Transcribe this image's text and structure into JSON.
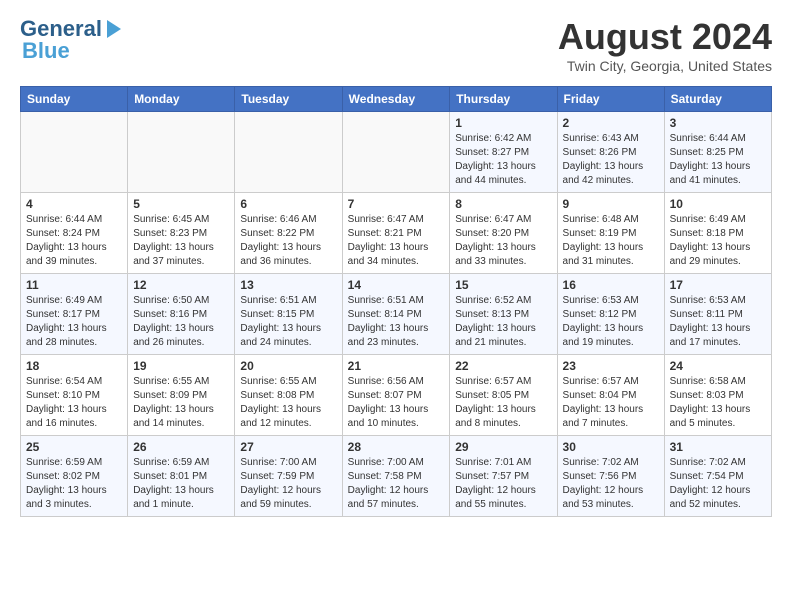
{
  "header": {
    "logo_line1": "General",
    "logo_line2": "Blue",
    "month_year": "August 2024",
    "location": "Twin City, Georgia, United States"
  },
  "weekdays": [
    "Sunday",
    "Monday",
    "Tuesday",
    "Wednesday",
    "Thursday",
    "Friday",
    "Saturday"
  ],
  "weeks": [
    [
      {
        "day": "",
        "sunrise": "",
        "sunset": "",
        "daylight": ""
      },
      {
        "day": "",
        "sunrise": "",
        "sunset": "",
        "daylight": ""
      },
      {
        "day": "",
        "sunrise": "",
        "sunset": "",
        "daylight": ""
      },
      {
        "day": "",
        "sunrise": "",
        "sunset": "",
        "daylight": ""
      },
      {
        "day": "1",
        "sunrise": "Sunrise: 6:42 AM",
        "sunset": "Sunset: 8:27 PM",
        "daylight": "Daylight: 13 hours and 44 minutes."
      },
      {
        "day": "2",
        "sunrise": "Sunrise: 6:43 AM",
        "sunset": "Sunset: 8:26 PM",
        "daylight": "Daylight: 13 hours and 42 minutes."
      },
      {
        "day": "3",
        "sunrise": "Sunrise: 6:44 AM",
        "sunset": "Sunset: 8:25 PM",
        "daylight": "Daylight: 13 hours and 41 minutes."
      }
    ],
    [
      {
        "day": "4",
        "sunrise": "Sunrise: 6:44 AM",
        "sunset": "Sunset: 8:24 PM",
        "daylight": "Daylight: 13 hours and 39 minutes."
      },
      {
        "day": "5",
        "sunrise": "Sunrise: 6:45 AM",
        "sunset": "Sunset: 8:23 PM",
        "daylight": "Daylight: 13 hours and 37 minutes."
      },
      {
        "day": "6",
        "sunrise": "Sunrise: 6:46 AM",
        "sunset": "Sunset: 8:22 PM",
        "daylight": "Daylight: 13 hours and 36 minutes."
      },
      {
        "day": "7",
        "sunrise": "Sunrise: 6:47 AM",
        "sunset": "Sunset: 8:21 PM",
        "daylight": "Daylight: 13 hours and 34 minutes."
      },
      {
        "day": "8",
        "sunrise": "Sunrise: 6:47 AM",
        "sunset": "Sunset: 8:20 PM",
        "daylight": "Daylight: 13 hours and 33 minutes."
      },
      {
        "day": "9",
        "sunrise": "Sunrise: 6:48 AM",
        "sunset": "Sunset: 8:19 PM",
        "daylight": "Daylight: 13 hours and 31 minutes."
      },
      {
        "day": "10",
        "sunrise": "Sunrise: 6:49 AM",
        "sunset": "Sunset: 8:18 PM",
        "daylight": "Daylight: 13 hours and 29 minutes."
      }
    ],
    [
      {
        "day": "11",
        "sunrise": "Sunrise: 6:49 AM",
        "sunset": "Sunset: 8:17 PM",
        "daylight": "Daylight: 13 hours and 28 minutes."
      },
      {
        "day": "12",
        "sunrise": "Sunrise: 6:50 AM",
        "sunset": "Sunset: 8:16 PM",
        "daylight": "Daylight: 13 hours and 26 minutes."
      },
      {
        "day": "13",
        "sunrise": "Sunrise: 6:51 AM",
        "sunset": "Sunset: 8:15 PM",
        "daylight": "Daylight: 13 hours and 24 minutes."
      },
      {
        "day": "14",
        "sunrise": "Sunrise: 6:51 AM",
        "sunset": "Sunset: 8:14 PM",
        "daylight": "Daylight: 13 hours and 23 minutes."
      },
      {
        "day": "15",
        "sunrise": "Sunrise: 6:52 AM",
        "sunset": "Sunset: 8:13 PM",
        "daylight": "Daylight: 13 hours and 21 minutes."
      },
      {
        "day": "16",
        "sunrise": "Sunrise: 6:53 AM",
        "sunset": "Sunset: 8:12 PM",
        "daylight": "Daylight: 13 hours and 19 minutes."
      },
      {
        "day": "17",
        "sunrise": "Sunrise: 6:53 AM",
        "sunset": "Sunset: 8:11 PM",
        "daylight": "Daylight: 13 hours and 17 minutes."
      }
    ],
    [
      {
        "day": "18",
        "sunrise": "Sunrise: 6:54 AM",
        "sunset": "Sunset: 8:10 PM",
        "daylight": "Daylight: 13 hours and 16 minutes."
      },
      {
        "day": "19",
        "sunrise": "Sunrise: 6:55 AM",
        "sunset": "Sunset: 8:09 PM",
        "daylight": "Daylight: 13 hours and 14 minutes."
      },
      {
        "day": "20",
        "sunrise": "Sunrise: 6:55 AM",
        "sunset": "Sunset: 8:08 PM",
        "daylight": "Daylight: 13 hours and 12 minutes."
      },
      {
        "day": "21",
        "sunrise": "Sunrise: 6:56 AM",
        "sunset": "Sunset: 8:07 PM",
        "daylight": "Daylight: 13 hours and 10 minutes."
      },
      {
        "day": "22",
        "sunrise": "Sunrise: 6:57 AM",
        "sunset": "Sunset: 8:05 PM",
        "daylight": "Daylight: 13 hours and 8 minutes."
      },
      {
        "day": "23",
        "sunrise": "Sunrise: 6:57 AM",
        "sunset": "Sunset: 8:04 PM",
        "daylight": "Daylight: 13 hours and 7 minutes."
      },
      {
        "day": "24",
        "sunrise": "Sunrise: 6:58 AM",
        "sunset": "Sunset: 8:03 PM",
        "daylight": "Daylight: 13 hours and 5 minutes."
      }
    ],
    [
      {
        "day": "25",
        "sunrise": "Sunrise: 6:59 AM",
        "sunset": "Sunset: 8:02 PM",
        "daylight": "Daylight: 13 hours and 3 minutes."
      },
      {
        "day": "26",
        "sunrise": "Sunrise: 6:59 AM",
        "sunset": "Sunset: 8:01 PM",
        "daylight": "Daylight: 13 hours and 1 minute."
      },
      {
        "day": "27",
        "sunrise": "Sunrise: 7:00 AM",
        "sunset": "Sunset: 7:59 PM",
        "daylight": "Daylight: 12 hours and 59 minutes."
      },
      {
        "day": "28",
        "sunrise": "Sunrise: 7:00 AM",
        "sunset": "Sunset: 7:58 PM",
        "daylight": "Daylight: 12 hours and 57 minutes."
      },
      {
        "day": "29",
        "sunrise": "Sunrise: 7:01 AM",
        "sunset": "Sunset: 7:57 PM",
        "daylight": "Daylight: 12 hours and 55 minutes."
      },
      {
        "day": "30",
        "sunrise": "Sunrise: 7:02 AM",
        "sunset": "Sunset: 7:56 PM",
        "daylight": "Daylight: 12 hours and 53 minutes."
      },
      {
        "day": "31",
        "sunrise": "Sunrise: 7:02 AM",
        "sunset": "Sunset: 7:54 PM",
        "daylight": "Daylight: 12 hours and 52 minutes."
      }
    ]
  ]
}
